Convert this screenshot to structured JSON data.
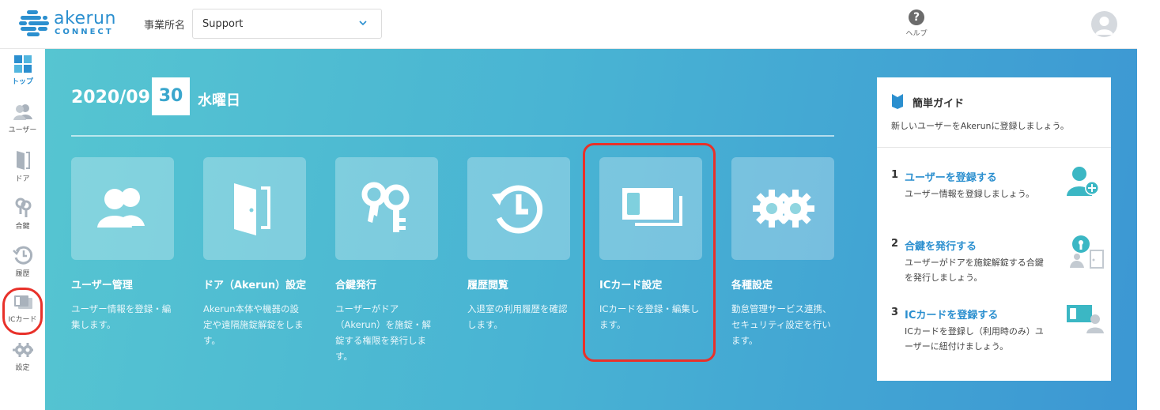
{
  "header": {
    "logo_word": "akerun",
    "logo_sub": "CONNECT",
    "office_label": "事業所名",
    "office_value": "Support",
    "help_label": "ヘルプ"
  },
  "sidebar": {
    "items": [
      {
        "label": "トップ",
        "icon": "grid-icon",
        "active": true
      },
      {
        "label": "ユーザー",
        "icon": "users-icon"
      },
      {
        "label": "ドア",
        "icon": "door-icon"
      },
      {
        "label": "合鍵",
        "icon": "key-icon"
      },
      {
        "label": "履歴",
        "icon": "history-icon"
      },
      {
        "label": "ICカード",
        "icon": "card-icon",
        "highlighted": true
      },
      {
        "label": "設定",
        "icon": "gear-icon"
      }
    ]
  },
  "date": {
    "year_month": "2020/09",
    "day": "30",
    "weekday": "水曜日"
  },
  "tiles": [
    {
      "title": "ユーザー管理",
      "desc": "ユーザー情報を登録・編集します。",
      "icon": "users-icon"
    },
    {
      "title": "ドア（Akerun）設定",
      "desc": "Akerun本体や機器の設定や遠隔施錠解錠をします。",
      "icon": "door-icon"
    },
    {
      "title": "合鍵発行",
      "desc": "ユーザーがドア（Akerun）を施錠・解錠する権限を発行します。",
      "icon": "keys-icon"
    },
    {
      "title": "履歴閲覧",
      "desc": "入退室の利用履歴を確認します。",
      "icon": "history-icon"
    },
    {
      "title": "ICカード設定",
      "desc": "ICカードを登録・編集します。",
      "icon": "card-icon",
      "highlighted": true
    },
    {
      "title": "各種設定",
      "desc": "勤怠管理サービス連携、セキュリティ設定を行います。",
      "icon": "gears-icon"
    }
  ],
  "guide": {
    "title": "簡単ガイド",
    "intro": "新しいユーザーをAkerunに登録しましょう。",
    "steps": [
      {
        "num": "1",
        "link": "ユーザーを登録する",
        "desc": "ユーザー情報を登録しましょう。",
        "icon": "add-user-icon"
      },
      {
        "num": "2",
        "link": "合鍵を発行する",
        "desc": "ユーザーがドアを施錠解錠する合鍵を発行しましょう。",
        "icon": "key-door-icon"
      },
      {
        "num": "3",
        "link": "ICカードを登録する",
        "desc": "ICカードを登録し（利用時のみ）ユーザーに紐付けましょう。",
        "icon": "card-user-icon"
      }
    ]
  },
  "colors": {
    "brand": "#2b8fcf",
    "highlight": "#e8312a",
    "gradient_start": "#56c5d1",
    "gradient_end": "#3c97d3"
  }
}
